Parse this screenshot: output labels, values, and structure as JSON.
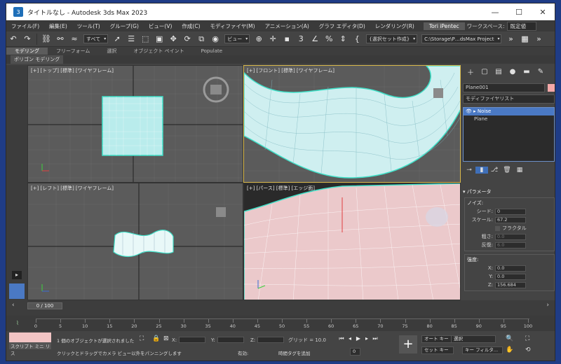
{
  "window": {
    "title": "タイトルなし - Autodesk 3ds Max 2023",
    "icon_label": "3",
    "controls": [
      "—",
      "☐",
      "✕"
    ]
  },
  "menu": {
    "items": [
      "ファイル(F)",
      "編集(E)",
      "ツール(T)",
      "グループ(G)",
      "ビュー(V)",
      "作成(C)",
      "モディファイヤ(M)",
      "アニメーション(A)",
      "グラフ エディタ(D)",
      "レンダリング(R)"
    ],
    "user": "Tori iPentec",
    "workspace_label": "ワークスペース:",
    "workspace_value": "既定値"
  },
  "toolbar": {
    "selection_filter": "すべて",
    "ref_coord": "ビュー",
    "named_sel": "{選択セット作成}",
    "project_path": "C:\\Storage\\P…dsMax Project"
  },
  "ribbon": {
    "tabs": [
      "モデリング",
      "フリーフォーム",
      "選択",
      "オブジェクト ペイント",
      "Populate"
    ],
    "sub": "ポリゴン モデリング"
  },
  "viewports": {
    "top": "[+] [トップ] [標準] [ワイヤフレーム]",
    "front": "[+] [フロント] [標準] [ワイヤフレーム]",
    "left": "[+] [レフト] [標準] [ワイヤフレーム]",
    "persp": "[+] [パース] [標準] [エッジ面]"
  },
  "command_panel": {
    "object_name": "Plane001",
    "object_color": "#f4a8a8",
    "modifier_list": "モディファイヤリスト",
    "stack": [
      "Noise",
      "Plane"
    ],
    "params_title": "パラメータ",
    "noise_group": "ノイズ:",
    "seed_label": "シード:",
    "seed_value": "0",
    "scale_label": "スケール:",
    "scale_value": "67.2",
    "fractal_label": "フラクタル",
    "rough_label": "粗さ:",
    "rough_value": "0.0",
    "iter_label": "反復:",
    "iter_value": "6.0",
    "strength_group": "強度:",
    "x_label": "X:",
    "x_value": "0.0",
    "y_label": "Y:",
    "y_value": "0.0",
    "z_label": "Z:",
    "z_value": "156.684"
  },
  "timeline": {
    "frame_slider": "0 / 100",
    "ticks": [
      "0",
      "5",
      "10",
      "15",
      "20",
      "25",
      "30",
      "35",
      "40",
      "45",
      "50",
      "55",
      "60",
      "65",
      "70",
      "75",
      "80",
      "85",
      "90",
      "95",
      "100"
    ]
  },
  "status": {
    "script_label": "スクリプト ミニ リス",
    "line1": "1 個のオブジェクトが選択されました",
    "line2": "クリックとドラッグでカメラ ビュー以外をパンニングします",
    "x": "X:",
    "y": "Y:",
    "z": "Z:",
    "grid": "グリッド = 10.0",
    "enabled": "有効:",
    "add_time_tag": "時間タグを追加",
    "auto_key": "オート キー",
    "set_key": "セット キー",
    "selected_sel": "選択",
    "key_filter": "キー フィルタ...",
    "frame": "0"
  },
  "colors": {
    "wire": "#dff4f4",
    "selected_wire": "#3fe0c8",
    "accent": "#4a79c4",
    "active_viewport": "#d8b84a"
  }
}
